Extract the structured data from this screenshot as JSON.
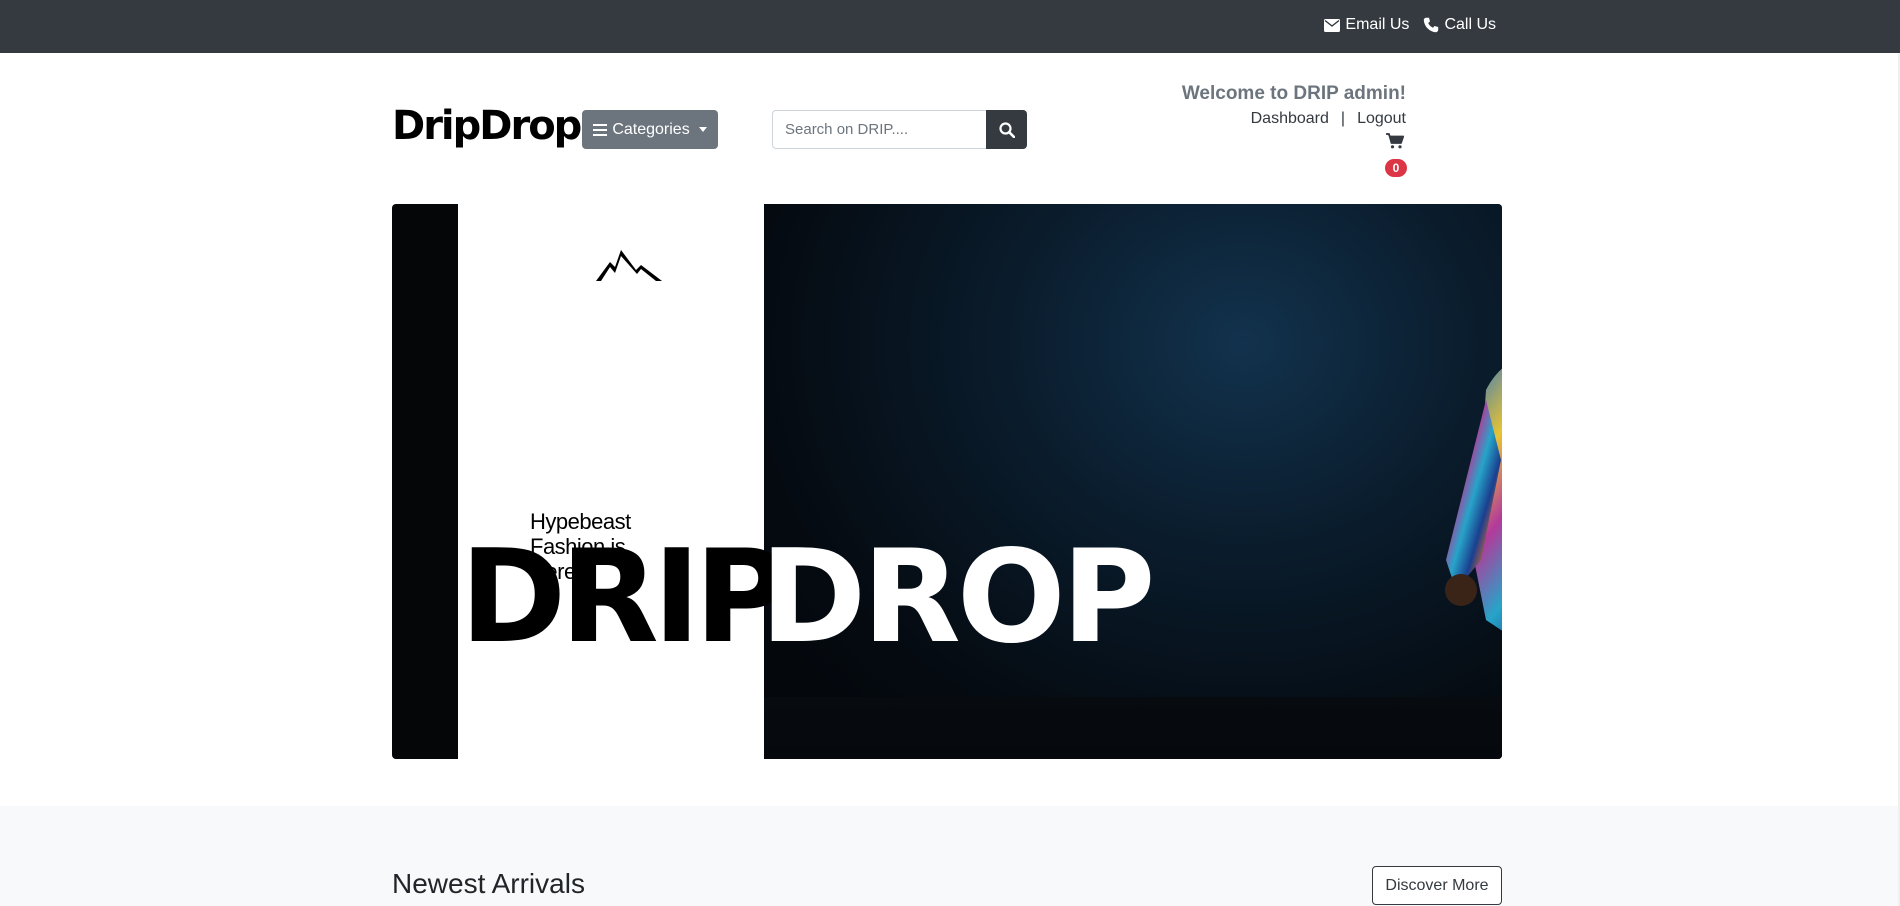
{
  "topbar": {
    "email_label": "Email Us",
    "call_label": "Call Us"
  },
  "header": {
    "logo": "DripDrop",
    "categories_label": "Categories",
    "search_placeholder": "Search on DRIP....",
    "welcome": "Welcome to DRIP admin!",
    "dashboard_label": "Dashboard",
    "separator": "|",
    "logout_label": "Logout",
    "cart_count": "0"
  },
  "hero": {
    "drip": "DRIP",
    "drop": "DROP",
    "tagline": "Hypebeast Fashion is Here"
  },
  "newest": {
    "title": "Newest Arrivals",
    "discover_label": "Discover More"
  }
}
